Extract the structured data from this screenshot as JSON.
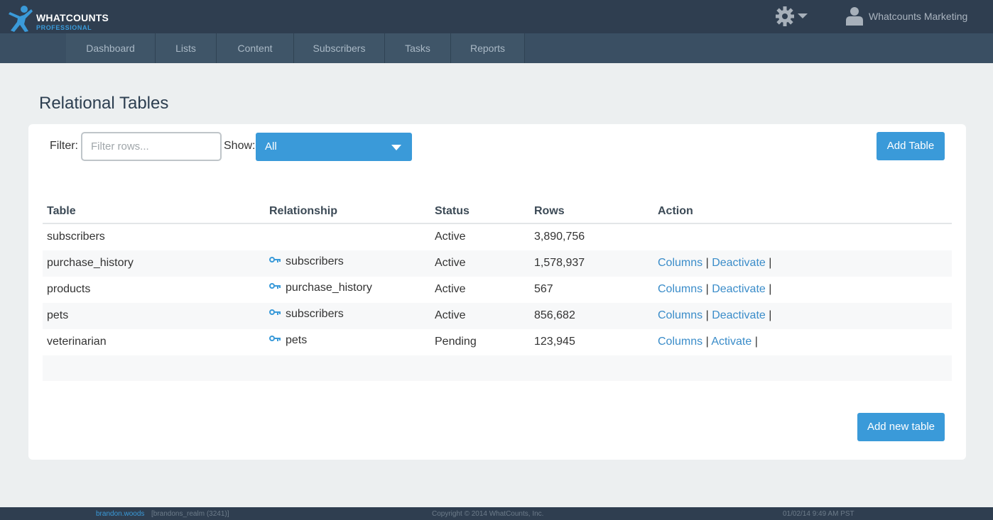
{
  "brand": {
    "name": "WHATCOUNTS",
    "edition": "PROFESSIONAL"
  },
  "header": {
    "user_name": "Whatcounts Marketing",
    "icons": [
      "gear-icon",
      "chevron-down-icon",
      "user-icon"
    ]
  },
  "nav": {
    "tabs": [
      {
        "label": "Dashboard"
      },
      {
        "label": "Lists"
      },
      {
        "label": "Content"
      },
      {
        "label": "Subscribers"
      },
      {
        "label": "Tasks"
      },
      {
        "label": "Reports"
      }
    ]
  },
  "page": {
    "title": "Relational Tables"
  },
  "toolbar": {
    "filter_label": "Filter:",
    "filter_placeholder": "Filter rows...",
    "filter_value": "",
    "show_label": "Show:",
    "show_value": "All",
    "add_table_label": "Add Table"
  },
  "table": {
    "columns": [
      "Table",
      "Relationship",
      "Status",
      "Rows",
      "Action"
    ],
    "rows": [
      {
        "table": "subscribers",
        "relationship": "",
        "status": "Active",
        "rows": "3,890,756",
        "actions": []
      },
      {
        "table": "purchase_history",
        "relationship": "subscribers",
        "status": "Active",
        "rows": "1,578,937",
        "actions": [
          "Columns",
          "Deactivate"
        ]
      },
      {
        "table": "products",
        "relationship": "purchase_history",
        "status": "Active",
        "rows": "567",
        "actions": [
          "Columns",
          "Deactivate"
        ]
      },
      {
        "table": "pets",
        "relationship": "subscribers",
        "status": "Active",
        "rows": "856,682",
        "actions": [
          "Columns",
          "Deactivate"
        ]
      },
      {
        "table": "veterinarian",
        "relationship": "pets",
        "status": "Pending",
        "rows": "123,945",
        "actions": [
          "Columns",
          "Activate"
        ]
      }
    ],
    "separator": "|"
  },
  "footer_actions": {
    "add_new_table_label": "Add new table"
  },
  "footer": {
    "user": "brandon.woods",
    "realm": "[brandons_realm (3241)]",
    "copyright": "Copyright © 2014 WhatCounts, Inc.",
    "datetime": "01/02/14 9:49 AM PST"
  },
  "colors": {
    "accent": "#3a9ad9",
    "header_bg": "#2f3e50",
    "nav_bg": "#3a4f63",
    "page_bg": "#eceff0"
  }
}
